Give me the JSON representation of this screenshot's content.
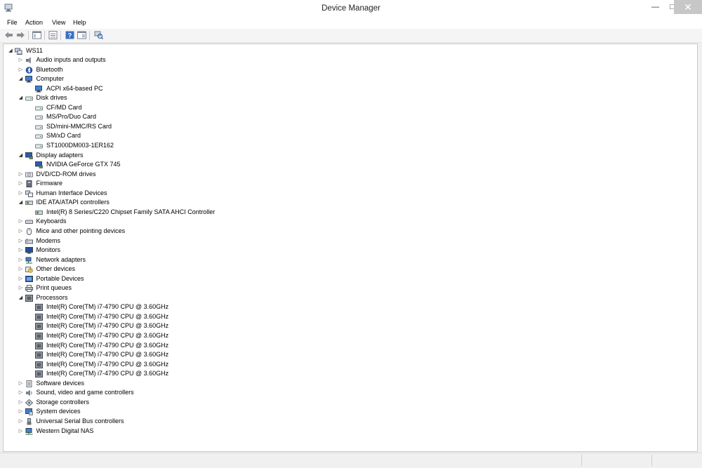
{
  "window": {
    "title": "Device Manager",
    "controls": {
      "minimize": "—",
      "maximize": "□",
      "close": "✕"
    }
  },
  "menu": {
    "items": [
      {
        "id": "file",
        "label": "File"
      },
      {
        "id": "action",
        "label": "Action"
      },
      {
        "id": "view",
        "label": "View"
      },
      {
        "id": "help",
        "label": "Help"
      }
    ]
  },
  "toolbar": {
    "buttons": [
      {
        "id": "back",
        "icon": "back-arrow-icon"
      },
      {
        "id": "forward",
        "icon": "forward-arrow-icon"
      },
      {
        "id": "console-tree",
        "icon": "console-tree-icon"
      },
      {
        "id": "properties",
        "icon": "properties-icon"
      },
      {
        "id": "help",
        "icon": "help-icon"
      },
      {
        "id": "action-pane",
        "icon": "action-pane-icon"
      },
      {
        "id": "scan-hardware",
        "icon": "scan-hardware-icon"
      }
    ]
  },
  "tree": {
    "root": {
      "label": "WS11",
      "icon": "computer-root-icon",
      "expanded": true
    },
    "nodes": [
      {
        "label": "Audio inputs and outputs",
        "icon": "audio-icon",
        "level": 1,
        "expanded": false
      },
      {
        "label": "Bluetooth",
        "icon": "bluetooth-icon",
        "level": 1,
        "expanded": false
      },
      {
        "label": "Computer",
        "icon": "computer-icon",
        "level": 1,
        "expanded": true
      },
      {
        "label": "ACPI x64-based PC",
        "icon": "computer-icon",
        "level": 2
      },
      {
        "label": "Disk drives",
        "icon": "disk-drive-icon",
        "level": 1,
        "expanded": true
      },
      {
        "label": "CF/MD Card",
        "icon": "disk-drive-icon",
        "level": 2
      },
      {
        "label": "MS/Pro/Duo Card",
        "icon": "disk-drive-icon",
        "level": 2
      },
      {
        "label": "SD/mini-MMC/RS Card",
        "icon": "disk-drive-icon",
        "level": 2
      },
      {
        "label": "SM/xD Card",
        "icon": "disk-drive-icon",
        "level": 2
      },
      {
        "label": "ST1000DM003-1ER162",
        "icon": "disk-drive-icon",
        "level": 2
      },
      {
        "label": "Display adapters",
        "icon": "display-adapter-icon",
        "level": 1,
        "expanded": true
      },
      {
        "label": "NVIDIA GeForce GTX 745",
        "icon": "display-adapter-icon",
        "level": 2
      },
      {
        "label": "DVD/CD-ROM drives",
        "icon": "dvd-drive-icon",
        "level": 1,
        "expanded": false
      },
      {
        "label": "Firmware",
        "icon": "firmware-icon",
        "level": 1,
        "expanded": false
      },
      {
        "label": "Human Interface Devices",
        "icon": "hid-icon",
        "level": 1,
        "expanded": false
      },
      {
        "label": "IDE ATA/ATAPI controllers",
        "icon": "ide-controller-icon",
        "level": 1,
        "expanded": true
      },
      {
        "label": "Intel(R) 8 Series/C220 Chipset Family SATA AHCI Controller",
        "icon": "ide-controller-icon",
        "level": 2
      },
      {
        "label": "Keyboards",
        "icon": "keyboard-icon",
        "level": 1,
        "expanded": false
      },
      {
        "label": "Mice and other pointing devices",
        "icon": "mouse-icon",
        "level": 1,
        "expanded": false
      },
      {
        "label": "Modems",
        "icon": "modem-icon",
        "level": 1,
        "expanded": false
      },
      {
        "label": "Monitors",
        "icon": "monitor-icon",
        "level": 1,
        "expanded": false
      },
      {
        "label": "Network adapters",
        "icon": "network-adapter-icon",
        "level": 1,
        "expanded": false
      },
      {
        "label": "Other devices",
        "icon": "other-devices-icon",
        "level": 1,
        "expanded": false
      },
      {
        "label": "Portable Devices",
        "icon": "portable-device-icon",
        "level": 1,
        "expanded": false
      },
      {
        "label": "Print queues",
        "icon": "printer-icon",
        "level": 1,
        "expanded": false
      },
      {
        "label": "Processors",
        "icon": "processor-icon",
        "level": 1,
        "expanded": true
      },
      {
        "label": "Intel(R) Core(TM) i7-4790 CPU @ 3.60GHz",
        "icon": "processor-icon",
        "level": 2
      },
      {
        "label": "Intel(R) Core(TM) i7-4790 CPU @ 3.60GHz",
        "icon": "processor-icon",
        "level": 2
      },
      {
        "label": "Intel(R) Core(TM) i7-4790 CPU @ 3.60GHz",
        "icon": "processor-icon",
        "level": 2
      },
      {
        "label": "Intel(R) Core(TM) i7-4790 CPU @ 3.60GHz",
        "icon": "processor-icon",
        "level": 2
      },
      {
        "label": "Intel(R) Core(TM) i7-4790 CPU @ 3.60GHz",
        "icon": "processor-icon",
        "level": 2
      },
      {
        "label": "Intel(R) Core(TM) i7-4790 CPU @ 3.60GHz",
        "icon": "processor-icon",
        "level": 2
      },
      {
        "label": "Intel(R) Core(TM) i7-4790 CPU @ 3.60GHz",
        "icon": "processor-icon",
        "level": 2
      },
      {
        "label": "Intel(R) Core(TM) i7-4790 CPU @ 3.60GHz",
        "icon": "processor-icon",
        "level": 2
      },
      {
        "label": "Software devices",
        "icon": "software-device-icon",
        "level": 1,
        "expanded": false
      },
      {
        "label": "Sound, video and game controllers",
        "icon": "sound-icon",
        "level": 1,
        "expanded": false
      },
      {
        "label": "Storage controllers",
        "icon": "storage-controller-icon",
        "level": 1,
        "expanded": false
      },
      {
        "label": "System devices",
        "icon": "system-device-icon",
        "level": 1,
        "expanded": false
      },
      {
        "label": "Universal Serial Bus controllers",
        "icon": "usb-icon",
        "level": 1,
        "expanded": false
      },
      {
        "label": "Western Digital NAS",
        "icon": "nas-icon",
        "level": 1,
        "expanded": false
      }
    ]
  },
  "glyphs": {
    "collapsed": "▷",
    "expanded": "◢"
  },
  "colors": {
    "window_bg": "#f0f0f0",
    "pane_bg": "#ffffff",
    "close_btn": "#c7c7c7"
  }
}
